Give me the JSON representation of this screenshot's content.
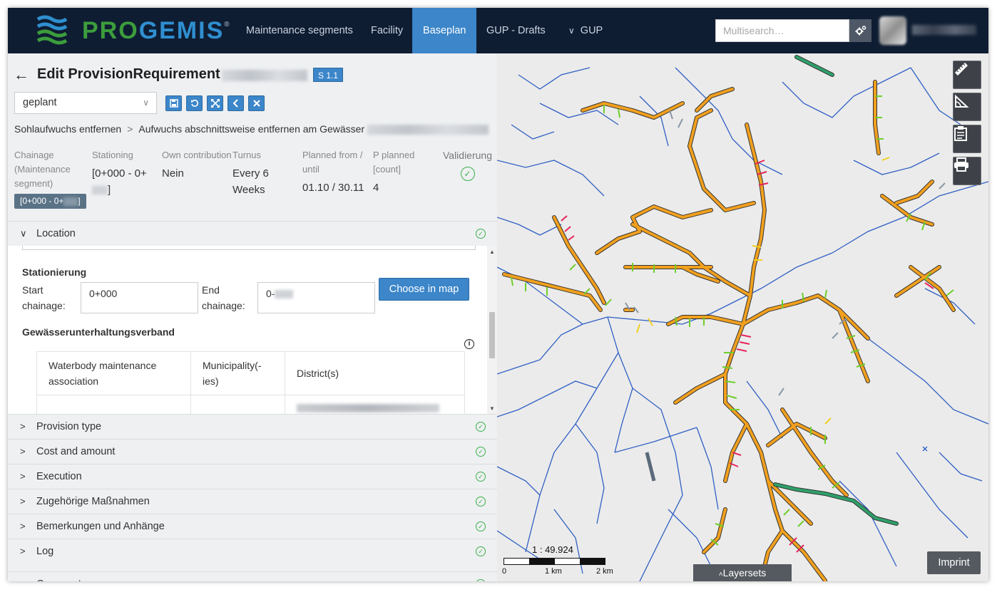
{
  "app": {
    "logo_text_pro": "PRO",
    "logo_text_gemis": "GEMIS",
    "logo_registered": "®",
    "nav": [
      {
        "label": "Maintenance segments",
        "active": false
      },
      {
        "label": "Facility",
        "active": false
      },
      {
        "label": "Baseplan",
        "active": true
      },
      {
        "label": "GUP - Drafts",
        "active": false
      },
      {
        "label": "GUP",
        "active": false
      }
    ],
    "search_placeholder": "Multisearch…",
    "accent_color": "#3c86c9",
    "nav_bg": "#0f1d33"
  },
  "editor": {
    "title": "Edit ProvisionRequirement",
    "version_badge": "S 1.1",
    "status_value": "geplant",
    "breadcrumb": [
      "Sohlaufwuchs entfernen",
      "Aufwuchs abschnittsweise entfernen am Gewässer"
    ],
    "breadcrumb_separator": ">",
    "summary": {
      "chainage_label": "Chainage (Maintenance segment)",
      "chainage_chip": "[0+000 - 0+",
      "chainage_chip_end": "]",
      "stationing_label": "Stationing",
      "stationing_value": "[0+000 - 0+",
      "stationing_value_end": "]",
      "own_contribution_label": "Own contribution",
      "own_contribution_value": "Nein",
      "turnus_label": "Turnus",
      "turnus_value": "Every 6 Weeks",
      "planned_label": "Planned from / until",
      "planned_value": "01.10 / 30.11",
      "p_planned_label": "P planned [count]",
      "p_planned_value": "4",
      "validation_label": "Validierung"
    }
  },
  "location": {
    "header": "Location",
    "stationierung_title": "Stationierung",
    "start_label": "Start chainage:",
    "start_value": "0+000",
    "end_label": "End chainage:",
    "end_value": "0-",
    "choose_button": "Choose in map",
    "association_title": "Gewässerunterhaltungsverband",
    "table_headers": [
      "Waterbody maintenance association",
      "Municipality(-ies)",
      "District(s)"
    ]
  },
  "sections": [
    {
      "label": "Provision type"
    },
    {
      "label": "Cost and amount"
    },
    {
      "label": "Execution"
    },
    {
      "label": "Zugehörige Maßnahmen"
    },
    {
      "label": "Bemerkungen und Anhänge"
    },
    {
      "label": "Log"
    },
    {
      "label": "Comments"
    }
  ],
  "map": {
    "scale_ratio": "1 : 49.924",
    "scale_labels": [
      "0",
      "1 km",
      "2 km"
    ],
    "layersets_label": "Layersets",
    "imprint_label": "Imprint",
    "tools": [
      "ruler-icon",
      "angle-icon",
      "clipboard-icon",
      "printer-icon"
    ],
    "colors": {
      "water": "#2f5fc4",
      "segment": "#f2a01e",
      "highlight": "#2fa06a",
      "tick_green": "#6fce2a",
      "tick_red": "#e8245c"
    }
  }
}
